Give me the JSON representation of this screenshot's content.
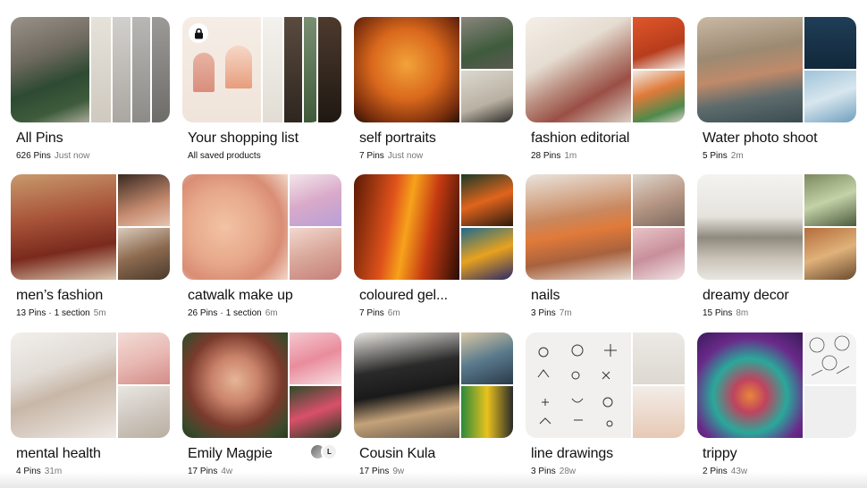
{
  "boards": [
    {
      "title": "All Pins",
      "pins": "626 Pins",
      "time": "Just now"
    },
    {
      "title": "Your shopping list",
      "pins": "All saved products",
      "time": ""
    },
    {
      "title": "self portraits",
      "pins": "7 Pins",
      "time": "Just now"
    },
    {
      "title": "fashion editorial",
      "pins": "28 Pins",
      "time": "1m"
    },
    {
      "title": "Water photo shoot",
      "pins": "5 Pins",
      "time": "2m"
    },
    {
      "title": "men’s fashion",
      "pins": "13 Pins",
      "section": "1 section",
      "time": "5m"
    },
    {
      "title": "catwalk make up",
      "pins": "26 Pins",
      "section": "1 section",
      "time": "6m"
    },
    {
      "title": "coloured gel...",
      "pins": "7 Pins",
      "time": "6m"
    },
    {
      "title": "nails",
      "pins": "3 Pins",
      "time": "7m"
    },
    {
      "title": "dreamy decor",
      "pins": "15 Pins",
      "time": "8m"
    },
    {
      "title": "mental health",
      "pins": "4 Pins",
      "time": "31m"
    },
    {
      "title": "Emily Magpie",
      "pins": "17 Pins",
      "time": "4w",
      "collaborator_initial": "L"
    },
    {
      "title": "Cousin Kula",
      "pins": "17 Pins",
      "time": "9w"
    },
    {
      "title": "line drawings",
      "pins": "3 Pins",
      "time": "28w"
    },
    {
      "title": "trippy",
      "pins": "2 Pins",
      "time": "43w"
    }
  ],
  "separator": "·",
  "icons": {
    "lock": "lock-icon"
  }
}
